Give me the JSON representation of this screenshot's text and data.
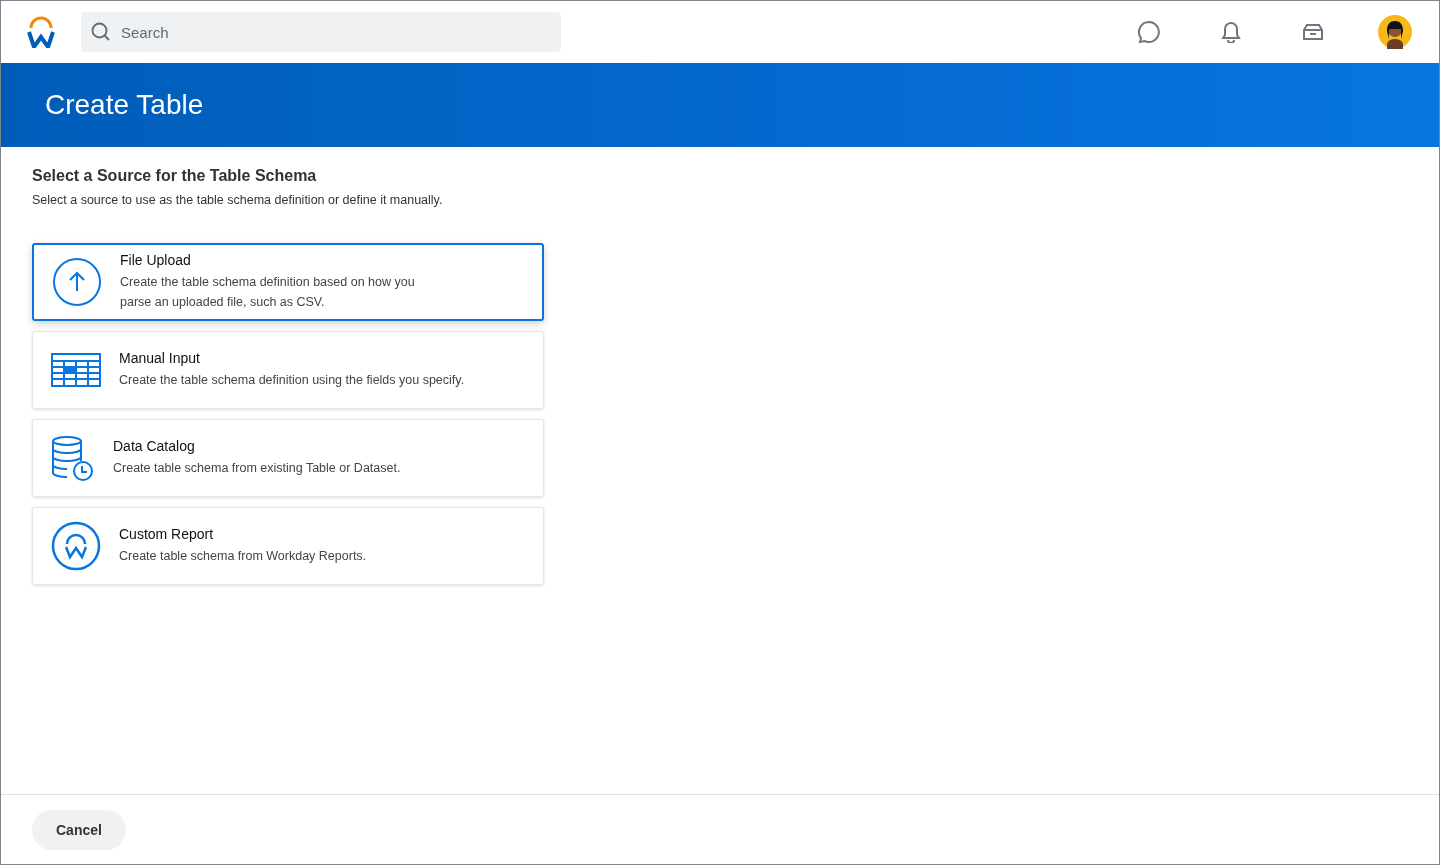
{
  "header": {
    "search": {
      "placeholder": "Search"
    }
  },
  "banner": {
    "title": "Create Table"
  },
  "section": {
    "heading": "Select a Source for the Table Schema",
    "subtitle": "Select a source to use as the table schema definition or define it manually."
  },
  "sources": [
    {
      "kind": "upload",
      "title": "File Upload",
      "description": "Create the table schema definition based on how you parse an uploaded file, such as CSV.",
      "selected": true
    },
    {
      "kind": "table",
      "title": "Manual Input",
      "description": "Create the table schema definition using the fields you specify.",
      "selected": false
    },
    {
      "kind": "database",
      "title": "Data Catalog",
      "description": "Create table schema from existing Table or Dataset.",
      "selected": false
    },
    {
      "kind": "report",
      "title": "Custom Report",
      "description": "Create table schema from Workday Reports.",
      "selected": false
    }
  ],
  "footer": {
    "buttons": [
      "Cancel"
    ]
  }
}
